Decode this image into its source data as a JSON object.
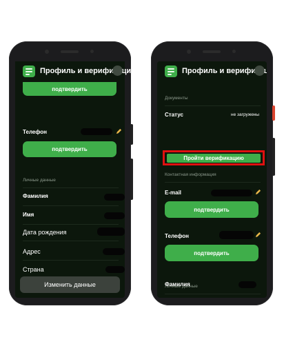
{
  "header": {
    "title": "Профиль и верификация"
  },
  "left_screen": {
    "confirm_label_1": "подтвердить",
    "phone_label": "Телефон",
    "confirm_label_2": "подтвердить",
    "personal_section": "Личные данные",
    "fields": {
      "surname": "Фамилия",
      "name": "Имя",
      "birthdate": "Дата рождения",
      "address": "Адрес",
      "country": "Страна"
    },
    "edit_button": "Изменить данные"
  },
  "right_screen": {
    "documents_section": "Документы",
    "status_label": "Статус",
    "status_value": "не загружены",
    "verify_button": "Пройти верификацию",
    "contact_section": "Контактная информация",
    "email_label": "E-mail",
    "confirm_label_1": "подтвердить",
    "phone_label": "Телефон",
    "confirm_label_2": "подтвердить",
    "personal_section": "Личные данные",
    "surname_label": "Фамилия"
  },
  "colors": {
    "accent_green": "#3fae4a",
    "screen_bg": "#0c170c",
    "highlight_red": "#e01010",
    "phone_body": "#1c1c1e"
  },
  "icons": [
    "menu-icon",
    "pencil-icon",
    "avatar-circle-icon"
  ]
}
